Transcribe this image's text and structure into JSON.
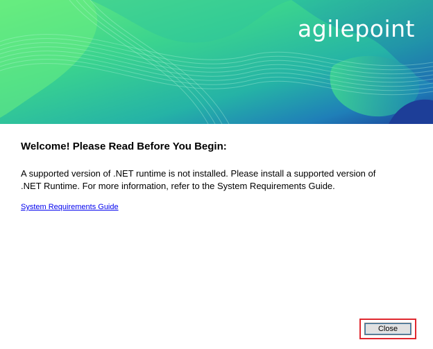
{
  "banner": {
    "logo_text": "agilepoint",
    "colors": {
      "green_light": "#5be585",
      "teal": "#2bbf9f",
      "blue": "#1f6fb2",
      "navy": "#1b3f9a"
    }
  },
  "content": {
    "heading": "Welcome! Please Read Before You Begin:",
    "message_line1": "A supported version of .NET runtime is not installed. Please install a supported version of",
    "message_line2": ".NET Runtime. For more information, refer to the System Requirements Guide.",
    "link_text": "System Requirements Guide"
  },
  "buttons": {
    "close_label": "Close",
    "highlight_color": "#e0272e"
  }
}
